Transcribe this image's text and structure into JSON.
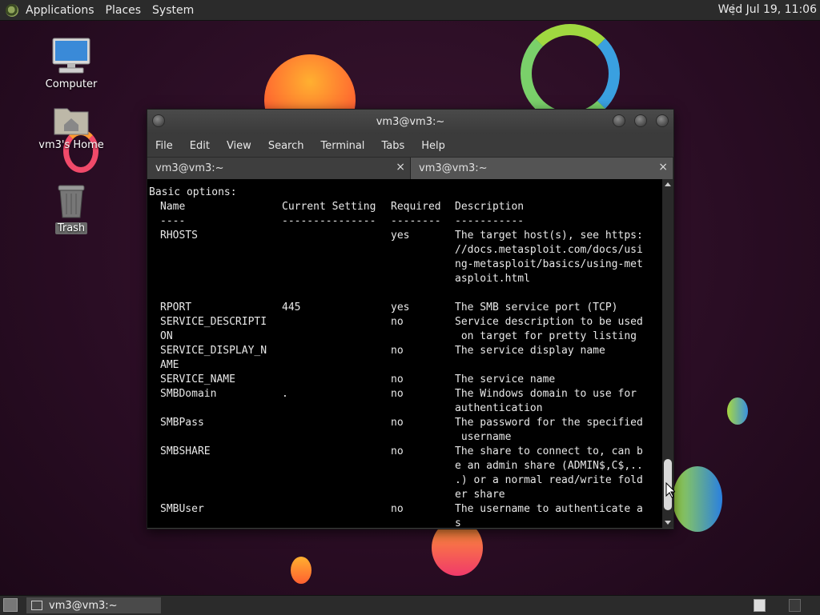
{
  "top_panel": {
    "menus": [
      "Applications",
      "Places",
      "System"
    ],
    "clock": "Wed Jul 19, 11:06"
  },
  "desktop_icons": {
    "computer": "Computer",
    "home": "vm3's Home",
    "trash": "Trash"
  },
  "window": {
    "title": "vm3@vm3:~",
    "menu": [
      "File",
      "Edit",
      "View",
      "Search",
      "Terminal",
      "Tabs",
      "Help"
    ],
    "tabs": [
      {
        "label": "vm3@vm3:~",
        "close": "×"
      },
      {
        "label": "vm3@vm3:~",
        "close": "×"
      }
    ]
  },
  "terminal": {
    "heading": "Basic options:",
    "columns": [
      "Name",
      "Current Setting",
      "Required",
      "Description"
    ],
    "dashes": [
      "----",
      "---------------",
      "--------",
      "-----------"
    ],
    "rows": [
      {
        "name": [
          "RHOSTS"
        ],
        "setting": "",
        "required": "yes",
        "desc": [
          "The target host(s), see https:",
          "//docs.metasploit.com/docs/usi",
          "ng-metasploit/basics/using-met",
          "asploit.html"
        ],
        "gap": true
      },
      {
        "name": [
          "RPORT"
        ],
        "setting": "445",
        "required": "yes",
        "desc": [
          "The SMB service port (TCP)"
        ]
      },
      {
        "name": [
          "SERVICE_DESCRIPTI",
          "ON"
        ],
        "setting": "",
        "required": "no",
        "desc": [
          "Service description to be used",
          " on target for pretty listing"
        ]
      },
      {
        "name": [
          "SERVICE_DISPLAY_N",
          "AME"
        ],
        "setting": "",
        "required": "no",
        "desc": [
          "The service display name"
        ]
      },
      {
        "name": [
          "SERVICE_NAME"
        ],
        "setting": "",
        "required": "no",
        "desc": [
          "The service name"
        ]
      },
      {
        "name": [
          "SMBDomain"
        ],
        "setting": ".",
        "required": "no",
        "desc": [
          "The Windows domain to use for",
          "authentication"
        ]
      },
      {
        "name": [
          "SMBPass"
        ],
        "setting": "",
        "required": "no",
        "desc": [
          "The password for the specified",
          " username"
        ]
      },
      {
        "name": [
          "SMBSHARE"
        ],
        "setting": "",
        "required": "no",
        "desc": [
          "The share to connect to, can b",
          "e an admin share (ADMIN$,C$,..",
          ".) or a normal read/write fold",
          "er share"
        ]
      },
      {
        "name": [
          "SMBUser"
        ],
        "setting": "",
        "required": "no",
        "desc": [
          "The username to authenticate a",
          "s"
        ]
      }
    ]
  },
  "taskbar": {
    "task_label": "vm3@vm3:~"
  }
}
